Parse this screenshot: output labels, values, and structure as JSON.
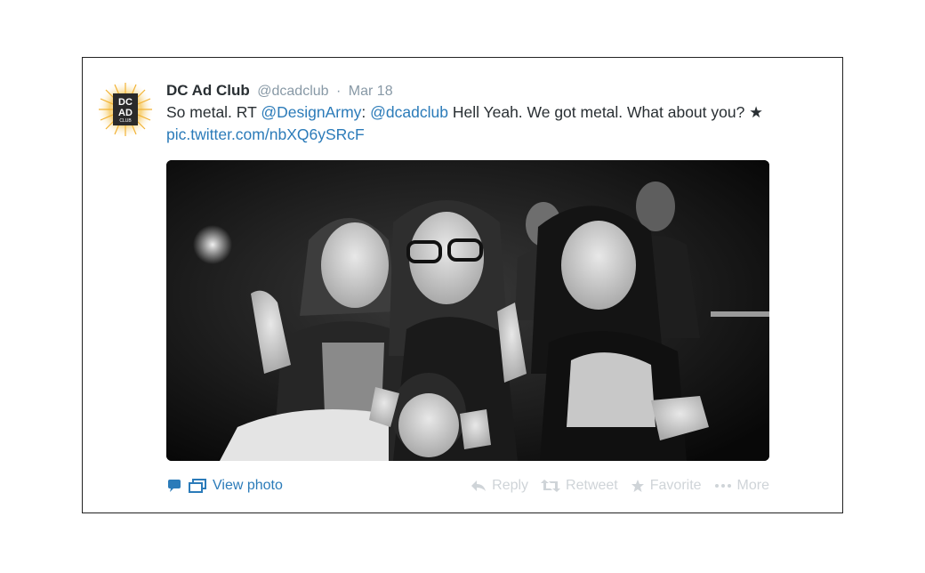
{
  "tweet": {
    "display_name": "DC Ad Club",
    "handle": "@dcadclub",
    "separator": "·",
    "date": "Mar 18",
    "avatar_logo_text": [
      "DC",
      "AD",
      "CLUB"
    ],
    "text": {
      "part1": "So metal. RT ",
      "mention1": "@DesignArmy",
      "part2": ": ",
      "mention2": "@dcadclub",
      "part3": " Hell Yeah. We got metal. What about you? ",
      "star": "★",
      "space": " ",
      "pic_link": "pic.twitter.com/nbXQ6ySRcF"
    }
  },
  "media": {
    "icon": "photo"
  },
  "actions": {
    "view_photo": "View photo",
    "reply": "Reply",
    "retweet": "Retweet",
    "favorite": "Favorite",
    "more": "More"
  },
  "colors": {
    "link": "#2b7bb9",
    "name": "#292f33",
    "muted": "#8899a6",
    "action_disabled": "#cfd4d8",
    "avatar_sun": "#f2b233"
  }
}
